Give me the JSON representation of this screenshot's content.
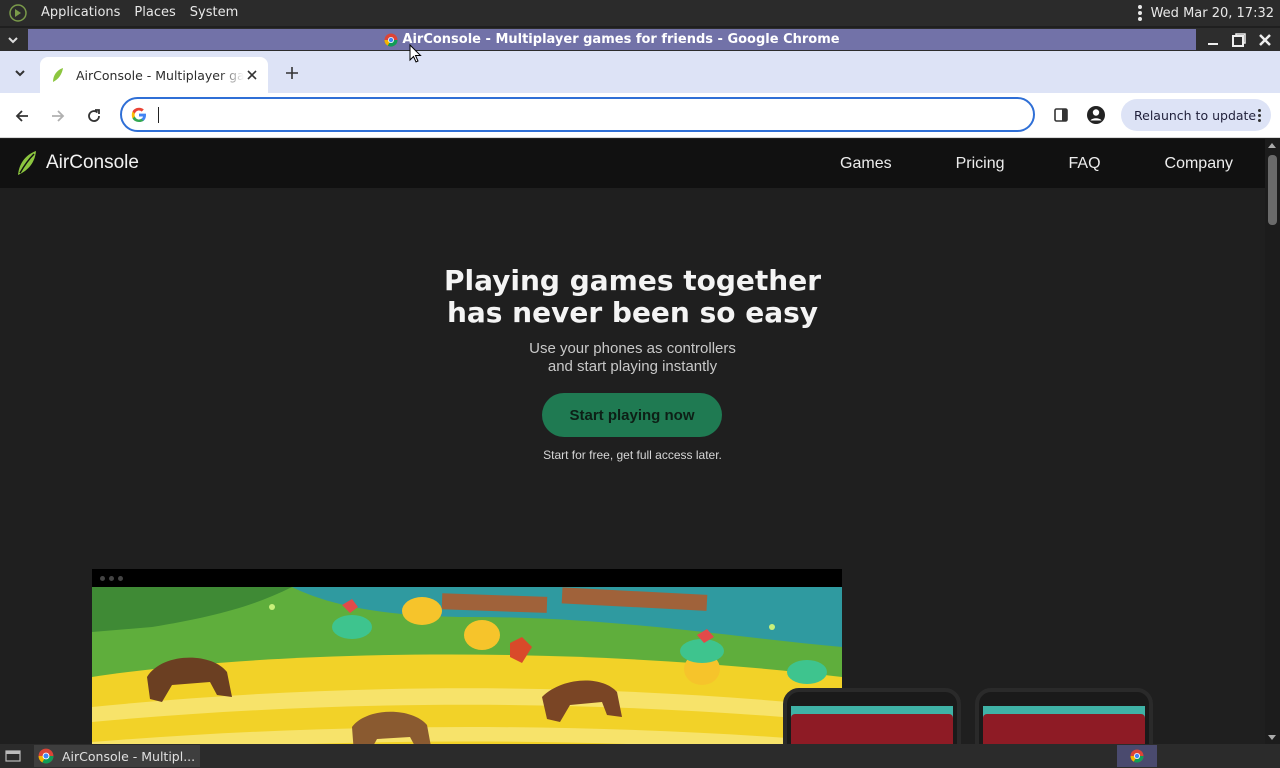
{
  "top_panel": {
    "menus": [
      "Applications",
      "Places",
      "System"
    ],
    "clock": "Wed Mar 20, 17:32"
  },
  "window": {
    "title": "AirConsole - Multiplayer games for friends - Google Chrome"
  },
  "chrome": {
    "tab_title": "AirConsole - Multiplayer games for friends",
    "omnibox": {
      "value": "",
      "placeholder": ""
    },
    "relaunch_label": "Relaunch to update"
  },
  "site": {
    "logo_text": "AirConsole",
    "nav": [
      "Games",
      "Pricing",
      "FAQ",
      "Company"
    ],
    "hero_title_line1": "Playing games together",
    "hero_title_line2": "has never been so easy",
    "hero_sub_line1": "Use your phones as controllers",
    "hero_sub_line2": "and start playing instantly",
    "cta_label": "Start playing now",
    "cta_note": "Start for free, get full access later."
  },
  "taskbar": {
    "task_label": "AirConsole - Multipl..."
  },
  "colors": {
    "accent_green": "#1f7a52",
    "title_active": "#7272a8",
    "omnibox_focus": "#2f6fd6"
  }
}
